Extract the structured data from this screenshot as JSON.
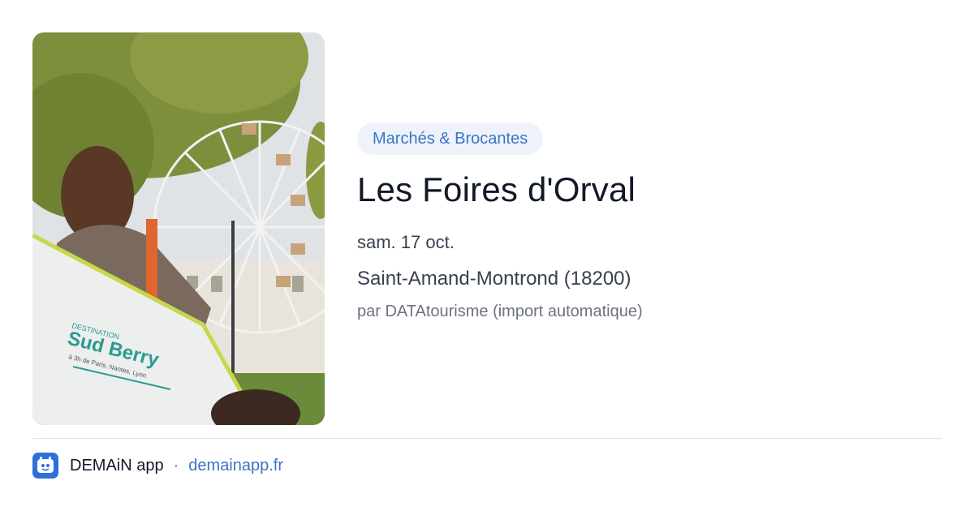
{
  "image": {
    "alt": "",
    "bag_text": {
      "line1": "DESTINATION",
      "line2": "Sud Berry",
      "line3": "à 3h de Paris, Nantes, Lyon"
    }
  },
  "event": {
    "category": "Marchés & Brocantes",
    "title": "Les Foires d'Orval",
    "date": "sam. 17 oct.",
    "location": "Saint-Amand-Montrond (18200)",
    "source": "par DATAtourisme (import automatique)"
  },
  "footer": {
    "app_name": "DEMAiN app",
    "separator": "·",
    "link": "demainapp.fr"
  },
  "colors": {
    "accent": "#3a75c4",
    "badge_bg": "#eef3fb",
    "logo_bg": "#2f6fd8"
  }
}
